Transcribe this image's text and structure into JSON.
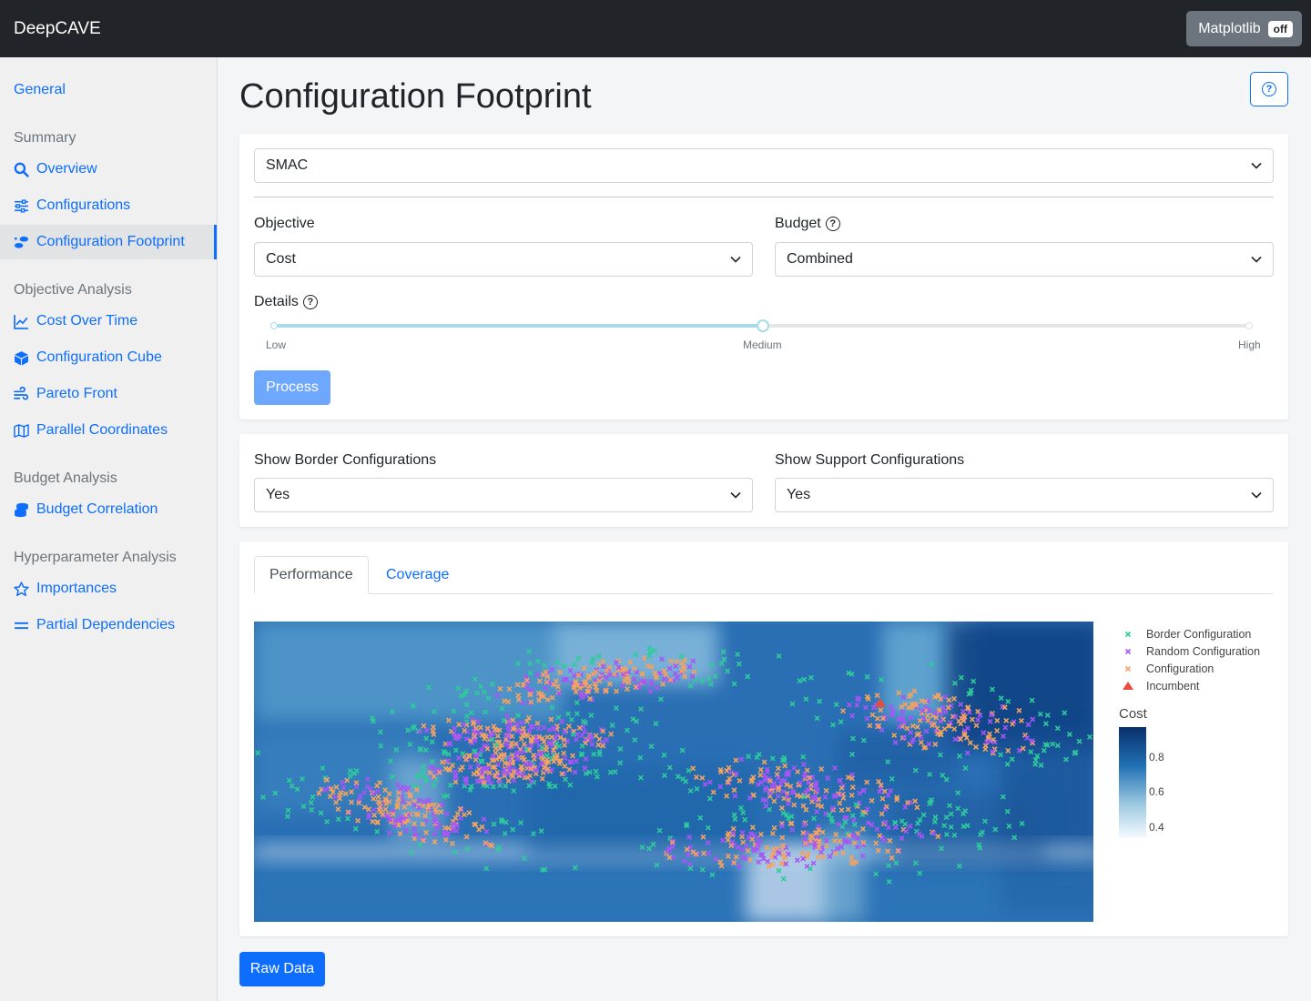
{
  "navbar": {
    "brand": "DeepCAVE",
    "matplotlib_label": "Matplotlib",
    "matplotlib_badge": "off"
  },
  "sidebar": {
    "general": "General",
    "sections": [
      {
        "heading": "Summary",
        "items": [
          "Overview",
          "Configurations",
          "Configuration Footprint"
        ]
      },
      {
        "heading": "Objective Analysis",
        "items": [
          "Cost Over Time",
          "Configuration Cube",
          "Pareto Front",
          "Parallel Coordinates"
        ]
      },
      {
        "heading": "Budget Analysis",
        "items": [
          "Budget Correlation"
        ]
      },
      {
        "heading": "Hyperparameter Analysis",
        "items": [
          "Importances",
          "Partial Dependencies"
        ]
      }
    ],
    "active_item": "Configuration Footprint"
  },
  "page": {
    "title": "Configuration Footprint"
  },
  "inputs": {
    "run": "SMAC",
    "objective_label": "Objective",
    "objective_value": "Cost",
    "budget_label": "Budget",
    "budget_value": "Combined",
    "details_label": "Details",
    "details_levels": [
      "Low",
      "Medium",
      "High"
    ],
    "details_value": "Medium",
    "process_label": "Process"
  },
  "filters": {
    "border_label": "Show Border Configurations",
    "border_value": "Yes",
    "support_label": "Show Support Configurations",
    "support_value": "Yes"
  },
  "tabs": {
    "items": [
      "Performance",
      "Coverage"
    ],
    "active": "Performance"
  },
  "chart_data": {
    "type": "heatmap",
    "legend": [
      "Border Configuration",
      "Random Configuration",
      "Configuration",
      "Incumbent"
    ],
    "colorbar_title": "Cost",
    "colorbar_ticks": [
      0.8,
      0.6,
      0.4
    ],
    "series_colors": {
      "Border Configuration": "#2ecc9a",
      "Random Configuration": "#a855f7",
      "Configuration": "#f4a261",
      "Incumbent": "#e74c3c"
    }
  },
  "raw_data_label": "Raw Data",
  "colors": {
    "accent": "#0d6efd",
    "navbar": "#212529"
  }
}
